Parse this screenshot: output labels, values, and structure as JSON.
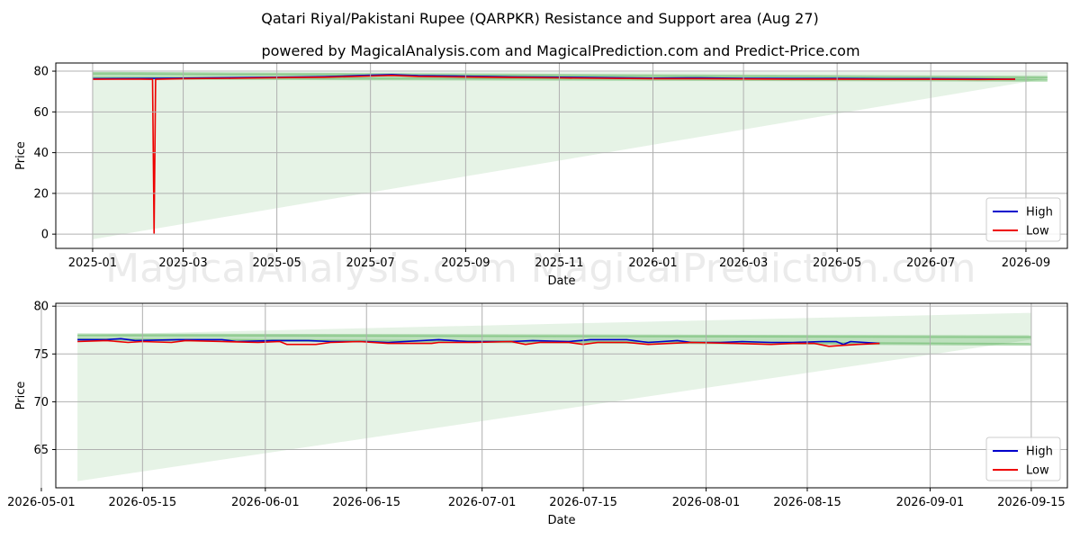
{
  "title": "Qatari Riyal/Pakistani Rupee (QARPKR) Resistance and Support area (Aug 27)",
  "subtitle": "powered by MagicalAnalysis.com and MagicalPrediction.com and Predict-Price.com",
  "watermarks": [
    "MagicalAnalysis.com",
    "MagicalPrediction.com"
  ],
  "colors": {
    "high": "#0000cc",
    "low": "#ee0000",
    "band": "#2e9e2e"
  },
  "chart_data": [
    {
      "type": "line",
      "xlabel": "Date",
      "ylabel": "Price",
      "x_ticks": [
        "2025-01",
        "2025-03",
        "2025-05",
        "2025-07",
        "2025-09",
        "2025-11",
        "2026-01",
        "2026-03",
        "2026-05",
        "2026-07",
        "2026-09"
      ],
      "y_ticks": [
        "0",
        "20",
        "40",
        "60",
        "80"
      ],
      "ylim": [
        -7,
        84
      ],
      "legend": {
        "placement": "lower-right",
        "entries": [
          "High",
          "Low"
        ]
      },
      "grid": true,
      "series": [
        {
          "name": "High",
          "points": [
            [
              "2025-01-01",
              76.3
            ],
            [
              "2025-02-01",
              76.4
            ],
            [
              "2025-02-15",
              76.5
            ],
            [
              "2025-03-01",
              76.6
            ],
            [
              "2025-04-01",
              76.8
            ],
            [
              "2025-05-01",
              77.0
            ],
            [
              "2025-06-01",
              77.3
            ],
            [
              "2025-07-01",
              78.0
            ],
            [
              "2025-07-15",
              78.3
            ],
            [
              "2025-08-01",
              77.8
            ],
            [
              "2025-09-01",
              77.5
            ],
            [
              "2025-10-01",
              77.2
            ],
            [
              "2025-11-01",
              77.0
            ],
            [
              "2025-12-01",
              76.8
            ],
            [
              "2026-01-01",
              76.6
            ],
            [
              "2026-02-01",
              76.7
            ],
            [
              "2026-03-01",
              76.5
            ],
            [
              "2026-04-01",
              76.4
            ],
            [
              "2026-05-01",
              76.4
            ],
            [
              "2026-06-01",
              76.3
            ],
            [
              "2026-07-01",
              76.3
            ],
            [
              "2026-08-01",
              76.2
            ],
            [
              "2026-08-25",
              76.1
            ]
          ]
        },
        {
          "name": "Low",
          "points": [
            [
              "2025-01-01",
              76.0
            ],
            [
              "2025-02-01",
              76.1
            ],
            [
              "2025-02-09",
              76.0
            ],
            [
              "2025-02-10",
              0.5
            ],
            [
              "2025-02-11",
              76.0
            ],
            [
              "2025-03-01",
              76.3
            ],
            [
              "2025-04-01",
              76.5
            ],
            [
              "2025-05-01",
              76.8
            ],
            [
              "2025-06-01",
              77.0
            ],
            [
              "2025-07-01",
              77.6
            ],
            [
              "2025-07-15",
              77.9
            ],
            [
              "2025-08-01",
              77.4
            ],
            [
              "2025-09-01",
              77.1
            ],
            [
              "2025-10-01",
              76.9
            ],
            [
              "2025-11-01",
              76.7
            ],
            [
              "2025-12-01",
              76.5
            ],
            [
              "2026-01-01",
              76.3
            ],
            [
              "2026-02-01",
              76.3
            ],
            [
              "2026-03-01",
              76.2
            ],
            [
              "2026-04-01",
              76.1
            ],
            [
              "2026-05-01",
              76.1
            ],
            [
              "2026-06-01",
              76.0
            ],
            [
              "2026-07-01",
              76.0
            ],
            [
              "2026-08-01",
              75.9
            ],
            [
              "2026-08-25",
              76.0
            ]
          ]
        }
      ],
      "support_band": {
        "start": "2025-01-01",
        "end": "2026-09-15",
        "upper_start": 79.0,
        "upper_end": 77.0,
        "lower_start": 76.5,
        "lower_end": 75.5
      },
      "prediction_fan": {
        "start": "2025-01-01",
        "end": "2026-09-15",
        "apex": 79.5,
        "upper_end": 79.5,
        "lower_start": -2.5,
        "lower_end": 76.5
      }
    },
    {
      "type": "line",
      "xlabel": "Date",
      "ylabel": "Price",
      "x_ticks": [
        "2026-05-01",
        "2026-05-15",
        "2026-06-01",
        "2026-06-15",
        "2026-07-01",
        "2026-07-15",
        "2026-08-01",
        "2026-08-15",
        "2026-09-01",
        "2026-09-15"
      ],
      "y_ticks": [
        "65",
        "70",
        "75",
        "80"
      ],
      "ylim": [
        61,
        80.3
      ],
      "legend": {
        "placement": "lower-right",
        "entries": [
          "High",
          "Low"
        ]
      },
      "grid": true,
      "series": [
        {
          "name": "High",
          "points": [
            [
              "2026-05-06",
              76.5
            ],
            [
              "2026-05-10",
              76.5
            ],
            [
              "2026-05-12",
              76.6
            ],
            [
              "2026-05-14",
              76.4
            ],
            [
              "2026-05-20",
              76.5
            ],
            [
              "2026-05-26",
              76.5
            ],
            [
              "2026-05-28",
              76.3
            ],
            [
              "2026-06-02",
              76.4
            ],
            [
              "2026-06-07",
              76.4
            ],
            [
              "2026-06-10",
              76.3
            ],
            [
              "2026-06-15",
              76.3
            ],
            [
              "2026-06-18",
              76.2
            ],
            [
              "2026-06-25",
              76.5
            ],
            [
              "2026-06-29",
              76.3
            ],
            [
              "2026-07-05",
              76.3
            ],
            [
              "2026-07-08",
              76.4
            ],
            [
              "2026-07-13",
              76.3
            ],
            [
              "2026-07-16",
              76.5
            ],
            [
              "2026-07-21",
              76.5
            ],
            [
              "2026-07-24",
              76.2
            ],
            [
              "2026-07-28",
              76.4
            ],
            [
              "2026-07-30",
              76.2
            ],
            [
              "2026-08-03",
              76.2
            ],
            [
              "2026-08-06",
              76.3
            ],
            [
              "2026-08-10",
              76.2
            ],
            [
              "2026-08-13",
              76.2
            ],
            [
              "2026-08-17",
              76.3
            ],
            [
              "2026-08-19",
              76.3
            ],
            [
              "2026-08-20",
              76.0
            ],
            [
              "2026-08-21",
              76.3
            ],
            [
              "2026-08-25",
              76.1
            ]
          ]
        },
        {
          "name": "Low",
          "points": [
            [
              "2026-05-06",
              76.3
            ],
            [
              "2026-05-10",
              76.4
            ],
            [
              "2026-05-13",
              76.2
            ],
            [
              "2026-05-15",
              76.3
            ],
            [
              "2026-05-19",
              76.2
            ],
            [
              "2026-05-21",
              76.4
            ],
            [
              "2026-05-26",
              76.3
            ],
            [
              "2026-05-31",
              76.2
            ],
            [
              "2026-06-03",
              76.3
            ],
            [
              "2026-06-04",
              76.0
            ],
            [
              "2026-06-08",
              76.0
            ],
            [
              "2026-06-10",
              76.2
            ],
            [
              "2026-06-14",
              76.3
            ],
            [
              "2026-06-18",
              76.1
            ],
            [
              "2026-06-24",
              76.1
            ],
            [
              "2026-06-25",
              76.2
            ],
            [
              "2026-06-30",
              76.2
            ],
            [
              "2026-07-05",
              76.3
            ],
            [
              "2026-07-07",
              76.0
            ],
            [
              "2026-07-09",
              76.2
            ],
            [
              "2026-07-13",
              76.2
            ],
            [
              "2026-07-15",
              76.0
            ],
            [
              "2026-07-17",
              76.2
            ],
            [
              "2026-07-21",
              76.2
            ],
            [
              "2026-07-24",
              76.0
            ],
            [
              "2026-07-30",
              76.2
            ],
            [
              "2026-08-05",
              76.1
            ],
            [
              "2026-08-10",
              76.0
            ],
            [
              "2026-08-13",
              76.1
            ],
            [
              "2026-08-16",
              76.1
            ],
            [
              "2026-08-18",
              75.8
            ],
            [
              "2026-08-20",
              75.9
            ],
            [
              "2026-08-22",
              76.0
            ],
            [
              "2026-08-25",
              76.1
            ]
          ]
        }
      ],
      "support_band": {
        "start": "2026-05-06",
        "end": "2026-09-15",
        "upper_start": 77.0,
        "upper_end": 76.8,
        "lower_start": 76.5,
        "lower_end": 76.0
      },
      "prediction_fan": {
        "start": "2026-05-06",
        "end": "2026-09-15",
        "apex": 77.0,
        "upper_end": 79.3,
        "lower_start": 61.7,
        "lower_end": 76.5
      }
    }
  ]
}
